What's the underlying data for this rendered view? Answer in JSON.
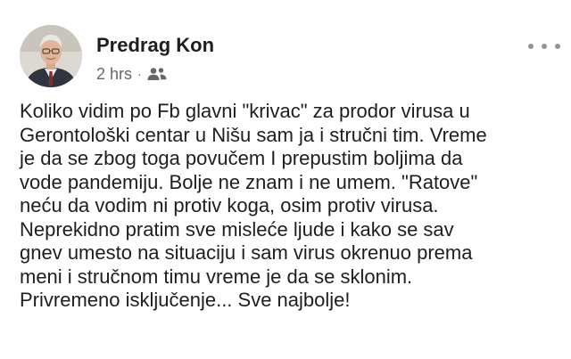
{
  "post": {
    "author": "Predrag Kon",
    "timestamp": "2 hrs",
    "separator": "·",
    "audience_icon": "friends-icon",
    "more_icon": "more-options-icon",
    "lines": [
      "Koliko vidim po Fb glavni \"krivac\" za prodor virusa u",
      "Gerontološki centar u Nišu sam ja i stručni tim. Vreme",
      "je da se zbog toga povučem I prepustim boljima da",
      "vode pandemiju. Bolje ne znam i ne umem. \"Ratove\"",
      "neću da vodim ni protiv koga, osim protiv virusa.",
      "Neprekidno pratim sve misleće ljude i kako se sav",
      "gnev umesto na situaciju i sam virus okrenuo prema",
      "meni i stručnom timu vreme je da se sklonim.",
      "Privremeno isključenje... Sve najbolje!"
    ]
  },
  "colors": {
    "text": "#1c1e21",
    "secondary_text": "#65676b",
    "icon_gray": "#8d949e",
    "background": "#ffffff"
  }
}
